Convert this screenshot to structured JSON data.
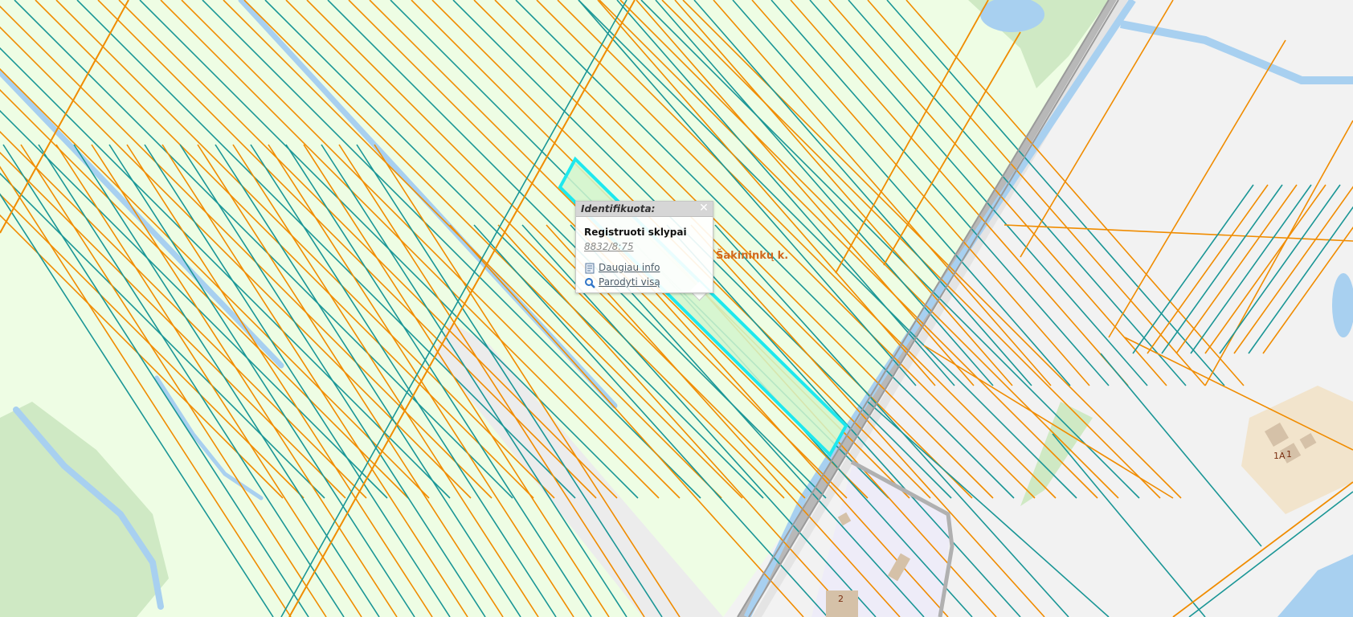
{
  "map": {
    "colors": {
      "background": "#f2f2f2",
      "field": "#eefde4",
      "meadow": "#cfe9c4",
      "water": "#a8d0f0",
      "building_area": "#f2e4cc",
      "building": "#d5c1a8",
      "site": "#eeecf8",
      "road": "#b8b8b8",
      "parcel_orange": "#f08c00",
      "parcel_teal": "#1a9696",
      "selected_outline": "#1ee8ee",
      "selected_fill": "#d2f5cd"
    },
    "street_label": "Šakininkų k.",
    "house_numbers": [
      "1A",
      "1",
      "2"
    ]
  },
  "popup": {
    "title": "Identifikuota:",
    "close_glyph": "✕",
    "section_title": "Registruoti sklypai",
    "parcel_id": "8832/8:75",
    "more_info_label": "Daugiau info",
    "more_info_icon": "document-icon",
    "show_all_label": "Parodyti visą",
    "show_all_icon": "magnifier-icon"
  }
}
